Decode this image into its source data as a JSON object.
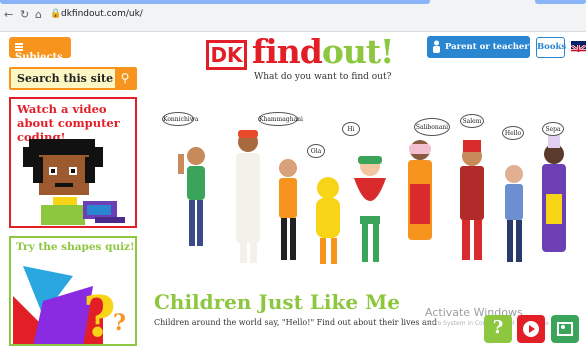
{
  "browser": {
    "url": "dkfindout.com/uk/",
    "back_icon": "arrow-left-icon",
    "forward_icon": "arrow-right-icon",
    "reload_icon": "reload-icon",
    "home_icon": "home-icon",
    "lock_icon": "lock-icon"
  },
  "header": {
    "subjects_label": "Subjects",
    "logo_dk": "DK",
    "logo_find": "find",
    "logo_out": "out!",
    "tagline": "What do you want to find out?",
    "parent_label": "Parent or teacher?",
    "books_label": "Books",
    "flag_icon": "uk-flag-icon"
  },
  "sidebar": {
    "search_placeholder": "Search this site",
    "promo_video": "Watch a video about computer coding!",
    "promo_quiz": "Try the shapes quiz!"
  },
  "hero": {
    "greetings": [
      "Konnichiwa",
      "Khammaghani",
      "Ola",
      "Hi",
      "Salibonani",
      "Salem",
      "Hello",
      "Sepa"
    ],
    "title": "Children Just Like Me",
    "description": "Children around the world say, \"Hello!\" Find out about their lives and"
  },
  "overlay": {
    "activate_title": "Activate Windows",
    "activate_sub": "Go to System in Control Panel to activate Windows."
  },
  "colors": {
    "red": "#e21f26",
    "orange": "#f7941d",
    "green": "#8dc63f",
    "blue": "#2a86d1"
  }
}
